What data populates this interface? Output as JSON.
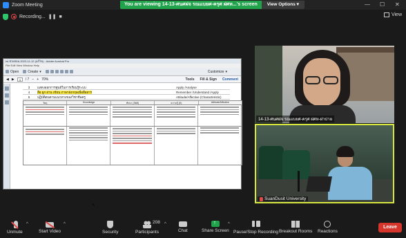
{
  "window": {
    "title": "Zoom Meeting",
    "controls": {
      "minimize": "—",
      "maximize": "☐",
      "close": "✕"
    }
  },
  "share_banner": {
    "message": "You are viewing 14-13-ศนศฝจ รณแบยศ-ครุศ ฝศห...'s screen",
    "view_options": "View Options"
  },
  "recording": {
    "label": "Recording...",
    "pause": "❚❚",
    "stop": "■"
  },
  "view": {
    "label": "View"
  },
  "document": {
    "window_title": "Ini.ช่วยสอน 2023-11-12 (แก้ไข) - Adobe Acrobat Pro",
    "menu": "File  Edit  View  Window  Help",
    "toolbar": {
      "open": "Open",
      "create": "Create",
      "customize": "Customize"
    },
    "nav": {
      "page": "4",
      "total": "/ 7",
      "zoom": "70%",
      "tools": "Tools",
      "fill_sign": "Fill & Sign",
      "comment": "Comment"
    },
    "objectives": [
      {
        "num": "3",
        "text": "แสดงออกการศูนย์ในการเรียนรู้ระบบ",
        "level": "Apply /Analyse",
        "highlight": false
      },
      {
        "num": "4",
        "text": "สื่อ ผูก อ่าน เขียน ภาษาอังกฤษเพื่อสื่อสาร",
        "level": "Remember /Understand /Apply",
        "highlight": true
      },
      {
        "num": "5",
        "text": "ปฏิบัติตนตามแนวทางของวิชาชีพครู",
        "level": "Attitude/Affective (Characteristic)",
        "highlight": false
      }
    ],
    "rubric_headers": [
      "วัตถุ",
      "Knowledge",
      "ทักษะ (Skill)",
      "ความรู้ (K)",
      "Attitude/Affective"
    ]
  },
  "participants": [
    {
      "name": "14-13-ศนศฝจ รณแบยศ-ครุศ ฝศห-ฝาปาย"
    },
    {
      "name": "SuanDusit University"
    }
  ],
  "toolbar": {
    "unmute": "Unmute",
    "start_video": "Start Video",
    "security": "Security",
    "participants": "Participants",
    "participants_count": "208",
    "chat": "Chat",
    "share_screen": "Share Screen",
    "record": "Pause/Stop Recording",
    "breakout": "Breakout Rooms",
    "reactions": "Reactions",
    "leave": "Leave"
  }
}
